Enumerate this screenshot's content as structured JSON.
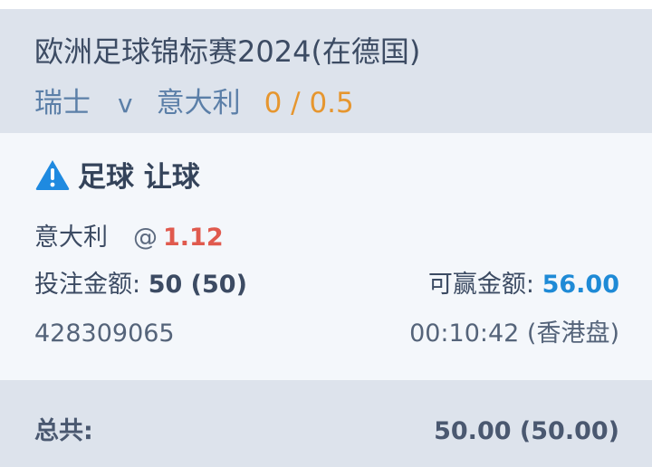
{
  "header": {
    "event_title": "欧洲足球锦标赛2024(在德国)",
    "home_team": "瑞士",
    "vs": "v",
    "away_team": "意大利",
    "handicap": "0 / 0.5"
  },
  "bet": {
    "type_label": "足球 让球",
    "warning_icon": "warning-triangle-icon",
    "selection": "意大利",
    "at_symbol": "@",
    "odds": "1.12",
    "stake_label": "投注金额:",
    "stake_value": "50 (50)",
    "win_label": "可赢金额:",
    "win_value": "56.00",
    "ticket_id": "428309065",
    "time_market": "00:10:42 (香港盘)"
  },
  "footer": {
    "total_label": "总共:",
    "total_value": "50.00 (50.00)"
  },
  "colors": {
    "header_bg": "#dde3ec",
    "card_bg": "#f4f7fb",
    "handicap": "#e6962f",
    "odds": "#e05a4e",
    "win_value": "#1e8ad6",
    "warning_icon": "#1f8ae0"
  }
}
